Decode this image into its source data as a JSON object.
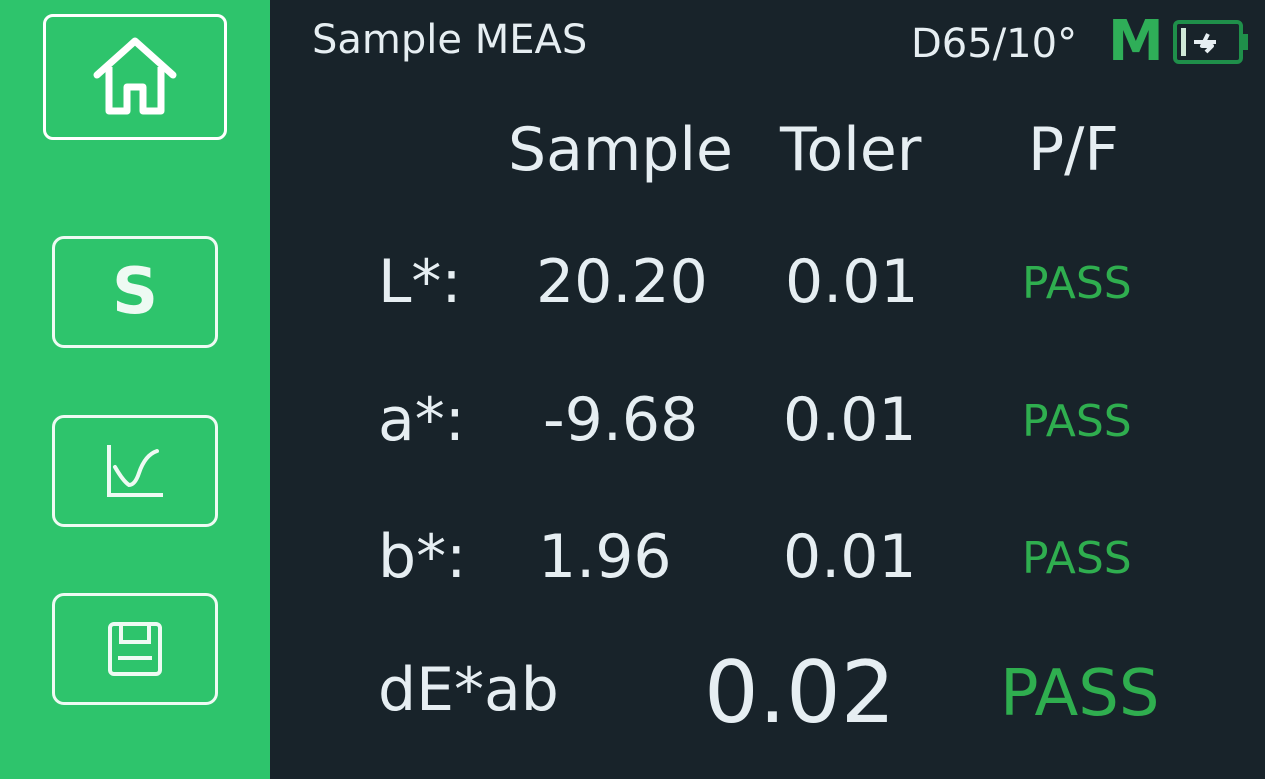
{
  "sidebar": {
    "items": [
      {
        "icon": "home-icon"
      },
      {
        "icon": "s-letter-icon",
        "label": "S"
      },
      {
        "icon": "curve-graph-icon"
      },
      {
        "icon": "save-disk-icon"
      }
    ]
  },
  "header": {
    "title": "Sample MEAS",
    "illuminant": "D65/10°",
    "mode": "M",
    "battery_icon": "battery-charging-icon"
  },
  "table": {
    "columns": [
      "Sample",
      "Toler",
      "P/F"
    ],
    "rows": [
      {
        "label": "L*:",
        "sample": "20.20",
        "toler": "0.01",
        "pf": "PASS"
      },
      {
        "label": "a*:",
        "sample": "-9.68",
        "toler": "0.01",
        "pf": "PASS"
      },
      {
        "label": "b*:",
        "sample": "1.96",
        "toler": "0.01",
        "pf": "PASS"
      }
    ]
  },
  "delta": {
    "label": "dE*ab",
    "value": "0.02",
    "pf": "PASS"
  },
  "colors": {
    "sidebar": "#2ec46c",
    "background": "#18232a",
    "pass": "#2fae4f",
    "text": "#e6eef2"
  }
}
